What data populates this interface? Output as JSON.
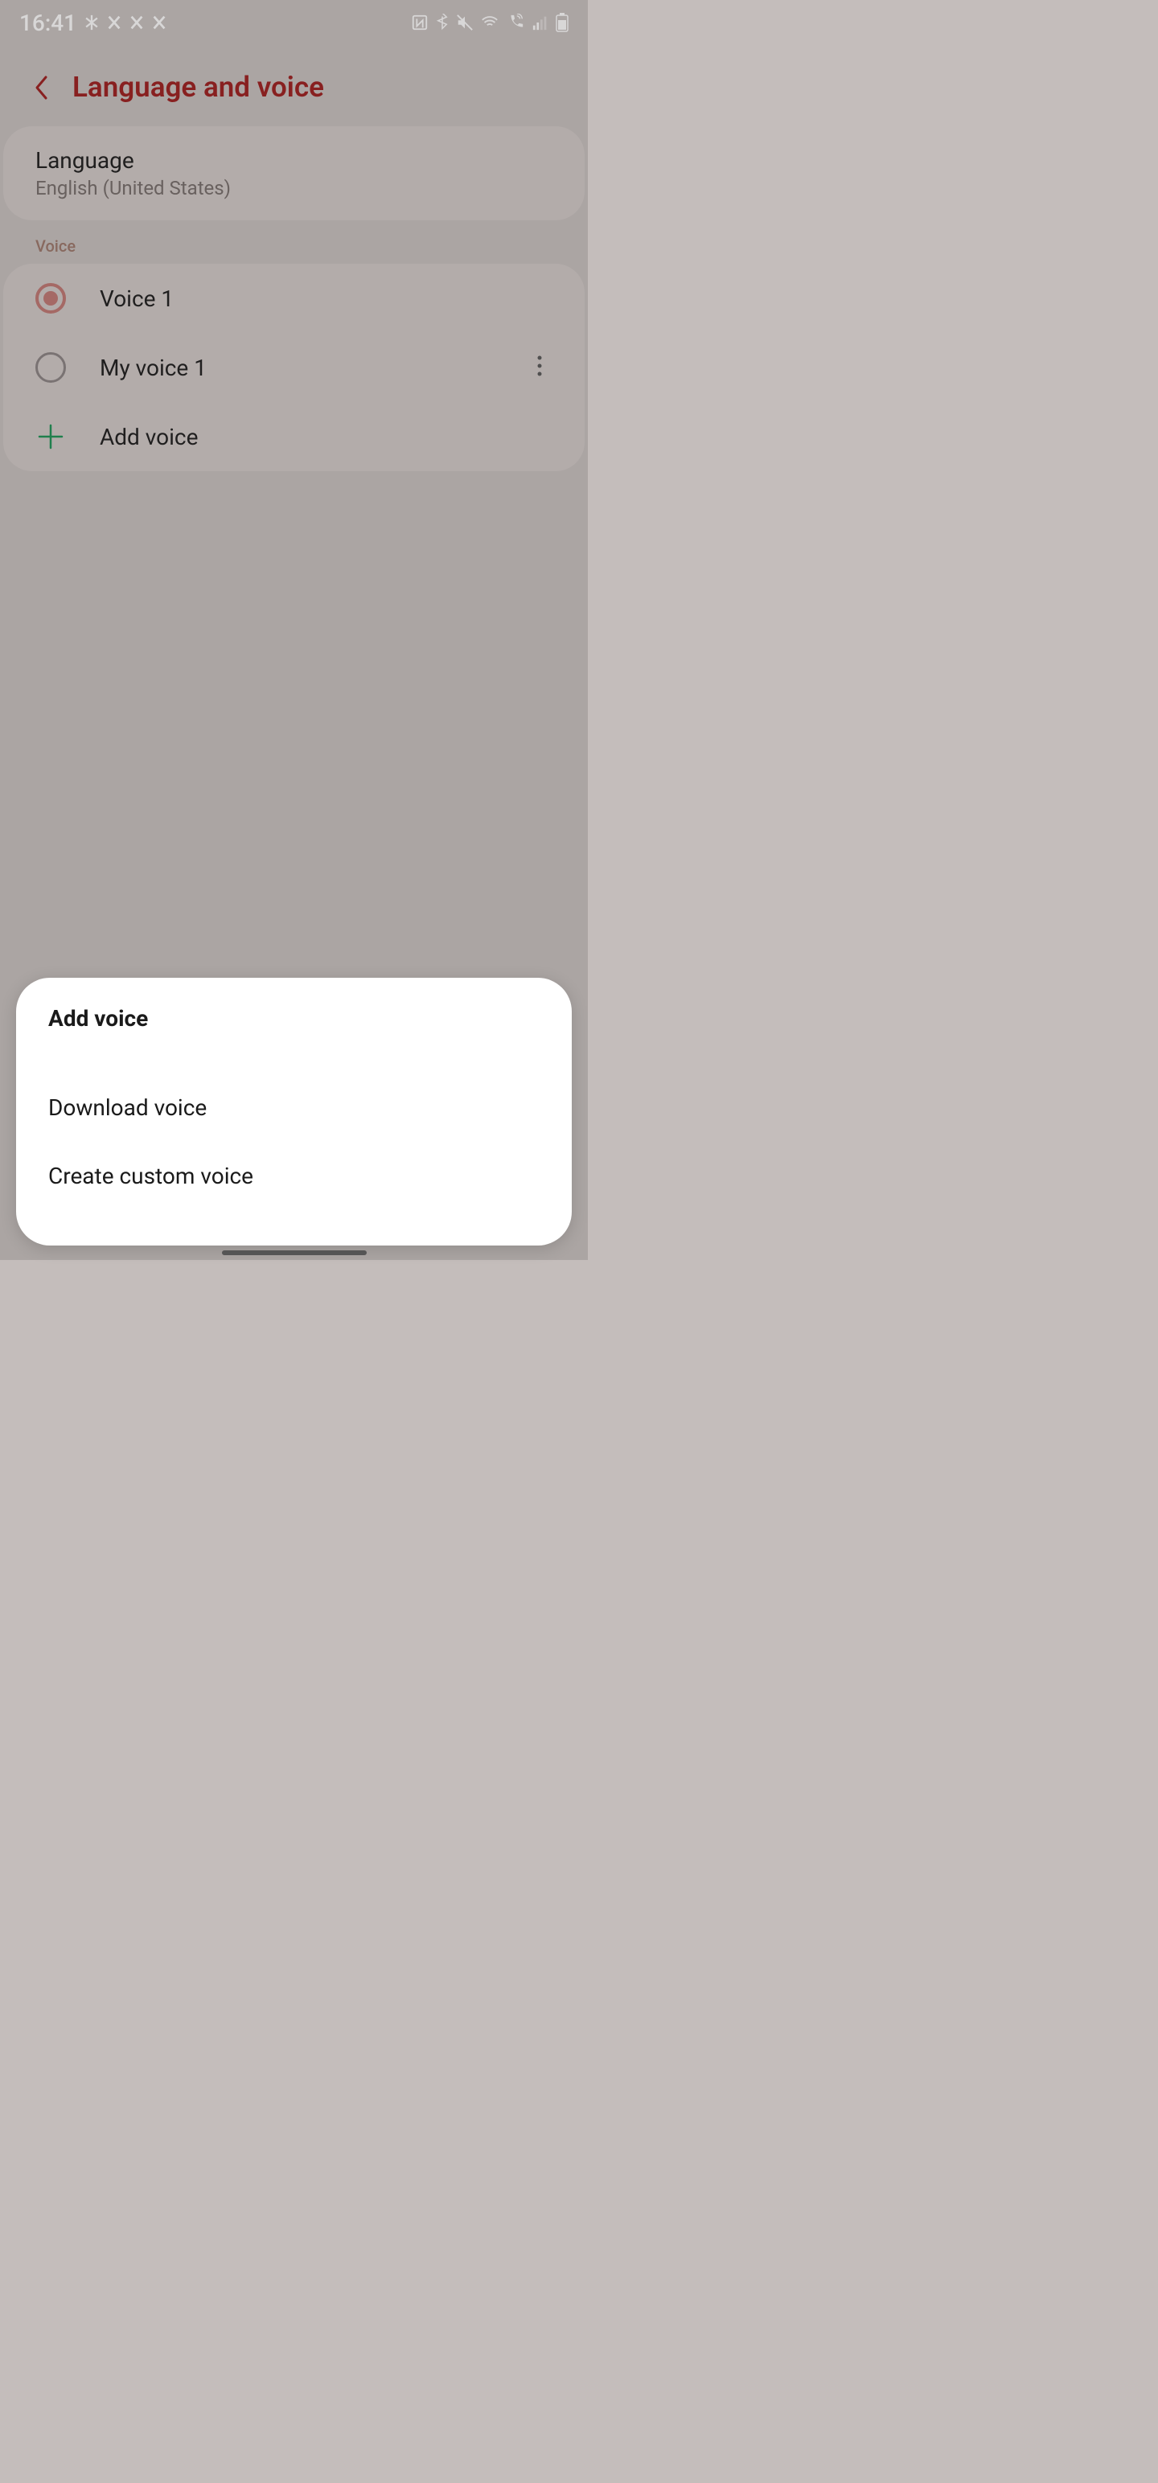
{
  "status": {
    "time": "16:41"
  },
  "header": {
    "title": "Language and voice"
  },
  "language": {
    "label": "Language",
    "value": "English (United States)"
  },
  "section": {
    "voice_label": "Voice"
  },
  "voices": {
    "option1": "Voice 1",
    "option2": "My voice 1",
    "add": "Add voice"
  },
  "sheet": {
    "title": "Add voice",
    "download": "Download voice",
    "create": "Create custom voice"
  }
}
